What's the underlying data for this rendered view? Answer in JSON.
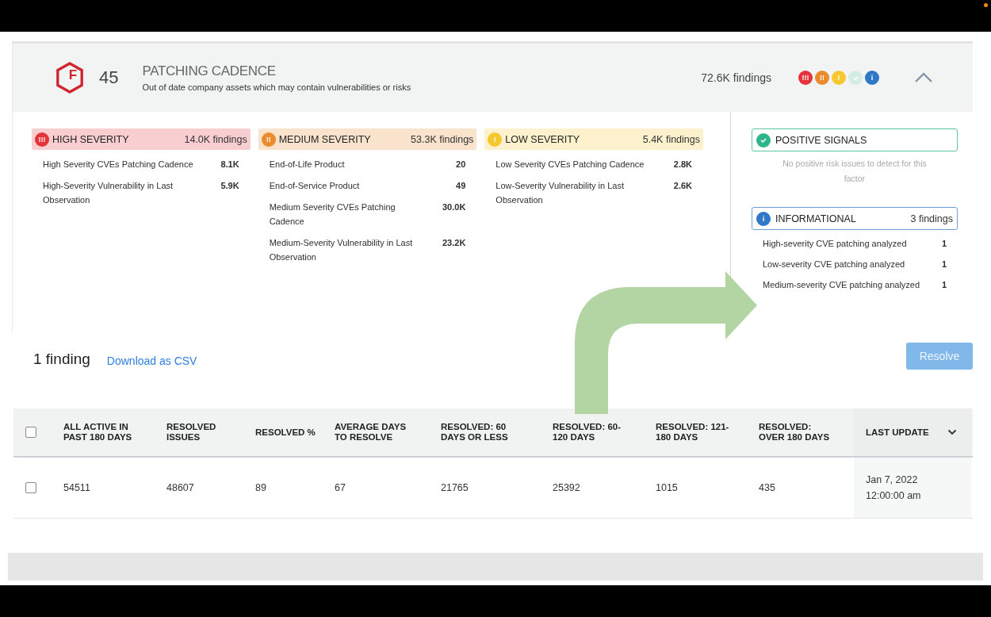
{
  "header": {
    "grade": "F",
    "score": "45",
    "title": "PATCHING CADENCE",
    "description": "Out of date company assets which may contain vulnerabilities or risks",
    "total": "72.6K findings",
    "expanded": true,
    "indicators": [
      {
        "kind": "high",
        "symbol": "!!!",
        "color": "#e5333b"
      },
      {
        "kind": "medium",
        "symbol": "!!",
        "color": "#ea8b2c"
      },
      {
        "kind": "low",
        "symbol": "!",
        "color": "#f6c830"
      },
      {
        "kind": "positive",
        "color": "#d3ede4"
      },
      {
        "kind": "info",
        "symbol": "i",
        "color": "#2f78c8"
      }
    ]
  },
  "severities": [
    {
      "symbol": "!!!",
      "label": "HIGH SEVERITY",
      "count": "14.0K findings",
      "color": "#e5333b",
      "items": [
        {
          "name": "High Severity CVEs Patching Cadence",
          "value": "8.1K"
        },
        {
          "name": "High-Severity Vulnerability in Last Observation",
          "value": "5.9K"
        }
      ]
    },
    {
      "symbol": "!!",
      "label": "MEDIUM SEVERITY",
      "count": "53.3K findings",
      "color": "#ea8b2c",
      "items": [
        {
          "name": "End-of-Life Product",
          "value": "20"
        },
        {
          "name": "End-of-Service Product",
          "value": "49"
        },
        {
          "name": "Medium Severity CVEs Patching Cadence",
          "value": "30.0K"
        },
        {
          "name": "Medium-Severity Vulnerability in Last Observation",
          "value": "23.2K"
        }
      ]
    },
    {
      "symbol": "!",
      "label": "LOW SEVERITY",
      "count": "5.4K findings",
      "color": "#f6c830",
      "items": [
        {
          "name": "Low Severity CVEs Patching Cadence",
          "value": "2.8K"
        },
        {
          "name": "Low-Severity Vulnerability in Last Observation",
          "value": "2.6K"
        }
      ]
    }
  ],
  "positive_signals": {
    "label": "POSITIVE SIGNALS",
    "message": "No positive risk issues to detect for this factor"
  },
  "informational": {
    "symbol": "i",
    "label": "INFORMATIONAL",
    "count": "3 findings",
    "items": [
      {
        "name": "High-severity CVE patching analyzed",
        "value": "1"
      },
      {
        "name": "Low-severity CVE patching analyzed",
        "value": "1"
      },
      {
        "name": "Medium-severity CVE patching analyzed",
        "value": "1"
      }
    ]
  },
  "findings": {
    "count": "1 finding",
    "download_link": "Download as CSV",
    "resolve_button": {
      "label": "Resolve",
      "disabled": true
    }
  },
  "table": {
    "select_all_checked": false,
    "columns": [
      {
        "label": "ALL ACTIVE IN PAST 180 DAYS",
        "sorted": false
      },
      {
        "label": "RESOLVED ISSUES",
        "sorted": false
      },
      {
        "label": "RESOLVED %",
        "sorted": false
      },
      {
        "label": "AVERAGE DAYS TO RESOLVE",
        "sorted": false
      },
      {
        "label": "RESOLVED: 60 DAYS OR LESS",
        "sorted": false
      },
      {
        "label": "RESOLVED: 60-120 DAYS",
        "sorted": false
      },
      {
        "label": "RESOLVED: 121-180 DAYS",
        "sorted": false
      },
      {
        "label": "RESOLVED: OVER 180 DAYS",
        "sorted": false
      },
      {
        "label": "LAST UPDATE",
        "sorted": true
      }
    ],
    "rows": [
      {
        "checked": false,
        "cells": [
          "54511",
          "48607",
          "89",
          "67",
          "21765",
          "25392",
          "1015",
          "435",
          "Jan 7, 2022 12:00:00 am"
        ]
      }
    ]
  }
}
